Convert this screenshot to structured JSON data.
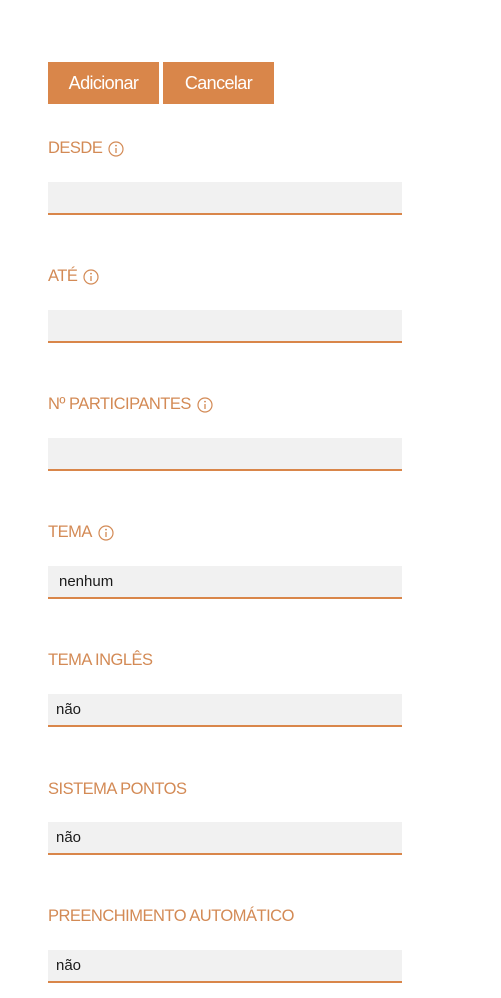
{
  "actions": {
    "add_label": "Adicionar",
    "cancel_label": "Cancelar"
  },
  "colors": {
    "accent": "#d9864a",
    "label": "#d38a55",
    "field_bg": "#f1f1f1"
  },
  "fields": [
    {
      "label": "DESDE",
      "info": true,
      "value": ""
    },
    {
      "label": "ATÉ",
      "info": true,
      "value": ""
    },
    {
      "label": "Nº PARTICIPANTES",
      "info": true,
      "value": ""
    },
    {
      "label": "TEMA",
      "info": true,
      "value": "nenhum"
    },
    {
      "label": "TEMA INGLÊS",
      "info": false,
      "value": "não"
    },
    {
      "label": "SISTEMA PONTOS",
      "info": false,
      "value": "não"
    },
    {
      "label": "PREENCHIMENTO AUTOMÁTICO",
      "info": false,
      "value": "não"
    }
  ]
}
